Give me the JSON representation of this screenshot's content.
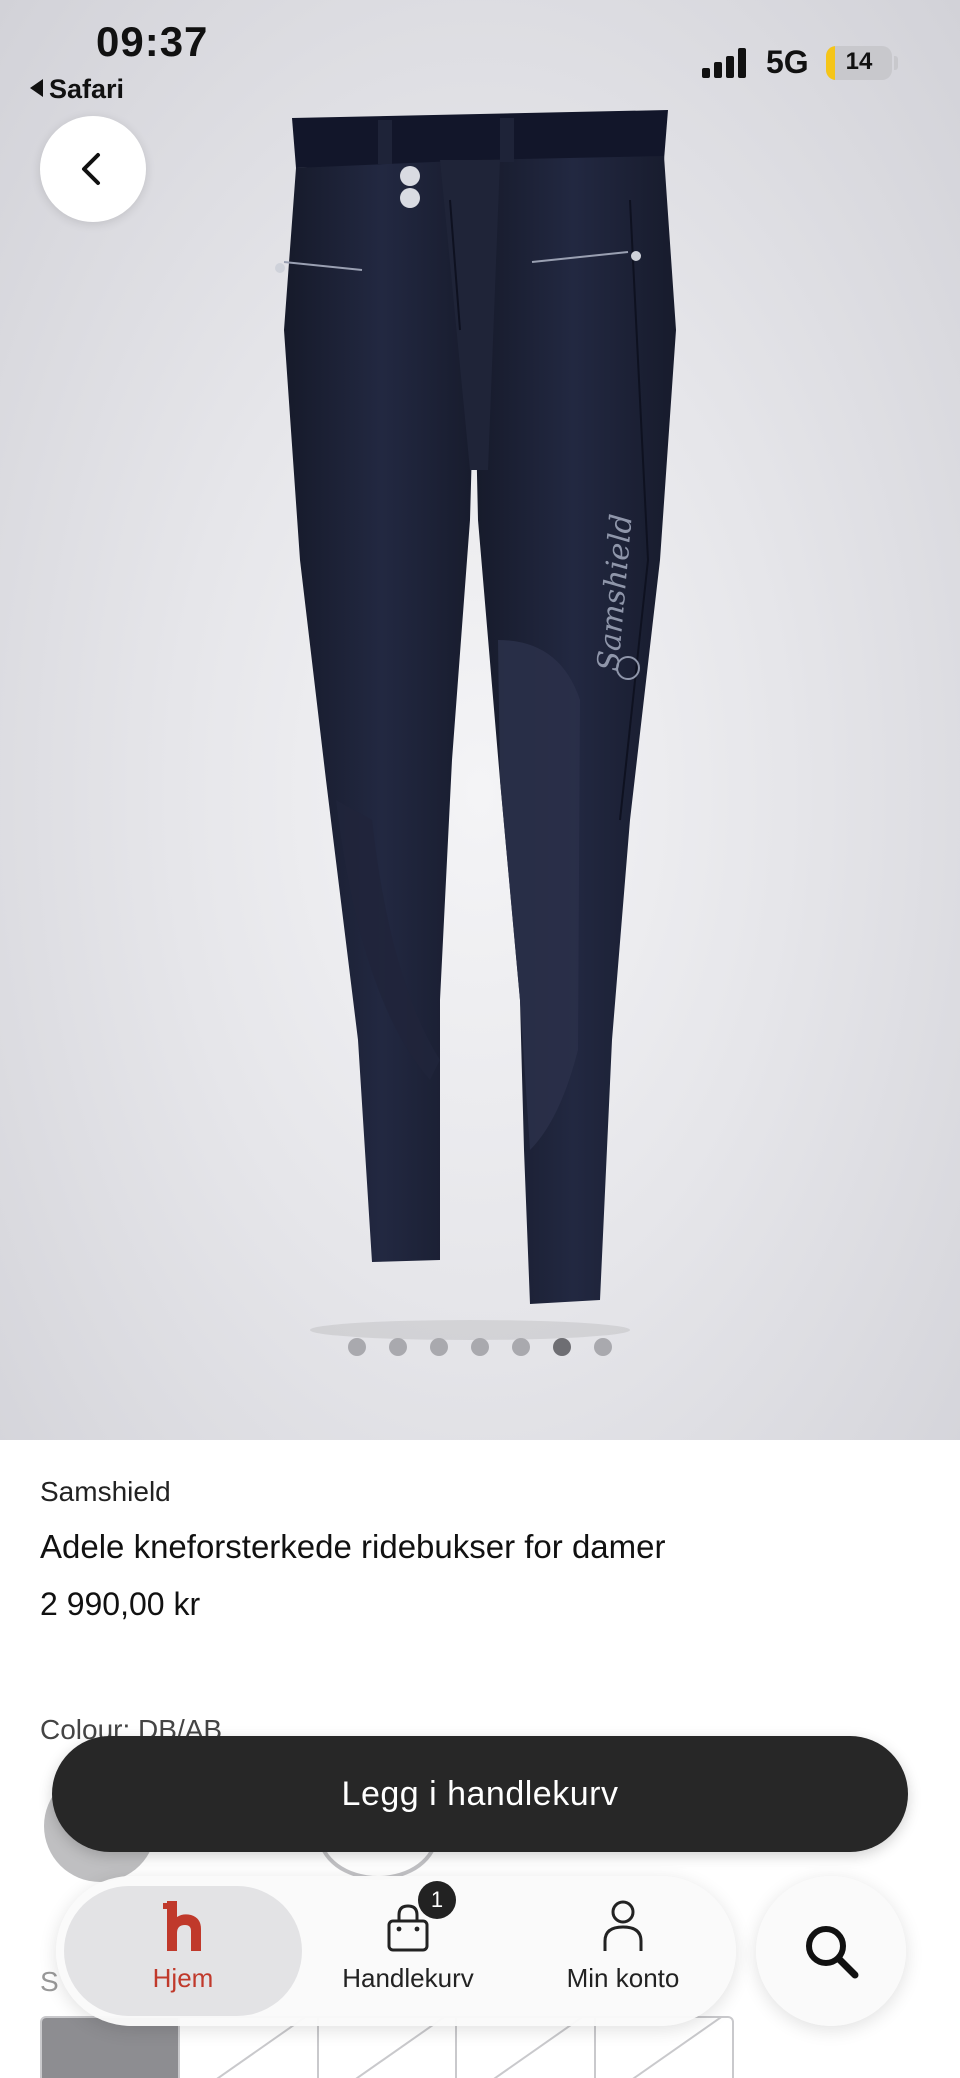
{
  "status_bar": {
    "time": "09:37",
    "back_app": "Safari",
    "network": "5G",
    "battery": "14",
    "battery_level_percent": 14
  },
  "gallery": {
    "image_count": 7,
    "active_index": 5
  },
  "product": {
    "brand": "Samshield",
    "name": "Adele kneforsterkede ridebukser for damer",
    "price": "2 990,00 kr",
    "colour_label": "Colour: DB/AB",
    "size_label": "S"
  },
  "actions": {
    "add_to_cart": "Legg i handlekurv"
  },
  "tabbar": {
    "items": [
      {
        "label": "Hjem",
        "icon": "home-logo-icon"
      },
      {
        "label": "Handlekurv",
        "icon": "shopping-bag-icon",
        "badge": "1"
      },
      {
        "label": "Min konto",
        "icon": "user-icon"
      }
    ]
  },
  "colors": {
    "accent_home": "#c0392b",
    "button_dark": "#272727",
    "pants_navy": "#1c2033"
  }
}
